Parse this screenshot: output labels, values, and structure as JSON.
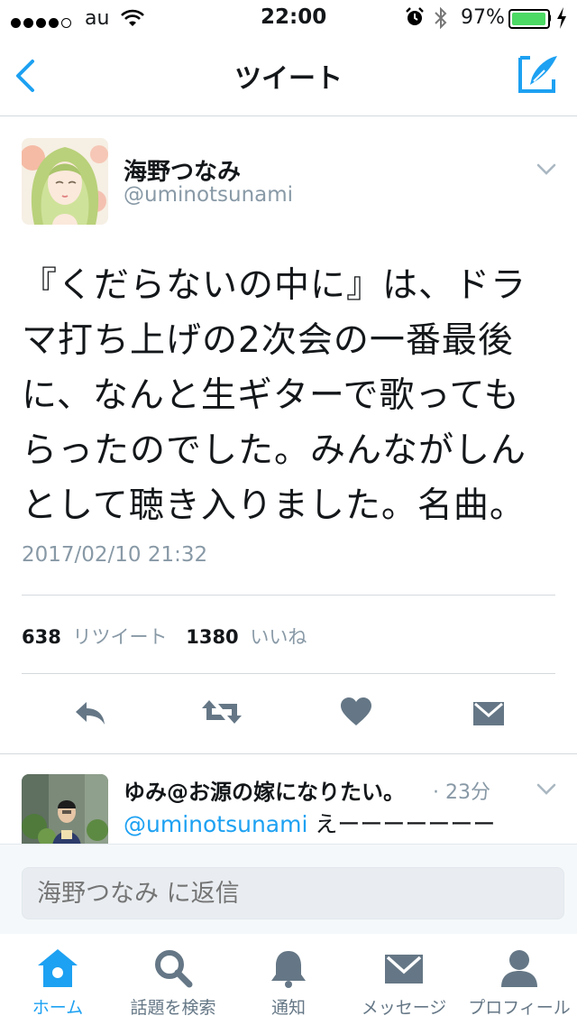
{
  "status_bar": {
    "carrier": "au",
    "time": "22:00",
    "battery": "97%"
  },
  "nav": {
    "title": "ツイート",
    "back_icon": "chevron-left-icon",
    "compose_icon": "compose-icon"
  },
  "tweet": {
    "display_name": "海野つなみ",
    "handle": "@uminotsunami",
    "text": "『くだらないの中に』は、ドラマ打ち上げの2次会の一番最後に、なんと生ギターで歌ってもらったのでした。みんながしんとして聴き入りました。名曲。",
    "timestamp": "2017/02/10 21:32",
    "retweet_count": "638",
    "retweet_label": "リツイート",
    "like_count": "1380",
    "like_label": "いいね"
  },
  "actions": {
    "reply_icon": "reply-icon",
    "retweet_icon": "retweet-icon",
    "like_icon": "heart-icon",
    "dm_icon": "envelope-icon"
  },
  "reply": {
    "display_name": "ゆみ@お源の嫁になりたい。",
    "time": "· 23分",
    "mention": "@uminotsunami",
    "text": " えーーーーーーー"
  },
  "reply_box": {
    "placeholder": "海野つなみ に返信"
  },
  "tab_bar": {
    "items": [
      {
        "label": "ホーム",
        "icon": "home-icon",
        "active": true
      },
      {
        "label": "話題を検索",
        "icon": "search-icon",
        "active": false
      },
      {
        "label": "通知",
        "icon": "bell-icon",
        "active": false
      },
      {
        "label": "メッセージ",
        "icon": "envelope-icon",
        "active": false
      },
      {
        "label": "プロフィール",
        "icon": "person-icon",
        "active": false
      }
    ]
  },
  "colors": {
    "accent": "#1da1f2",
    "heart": "#657786",
    "battery": "#4cd964"
  }
}
